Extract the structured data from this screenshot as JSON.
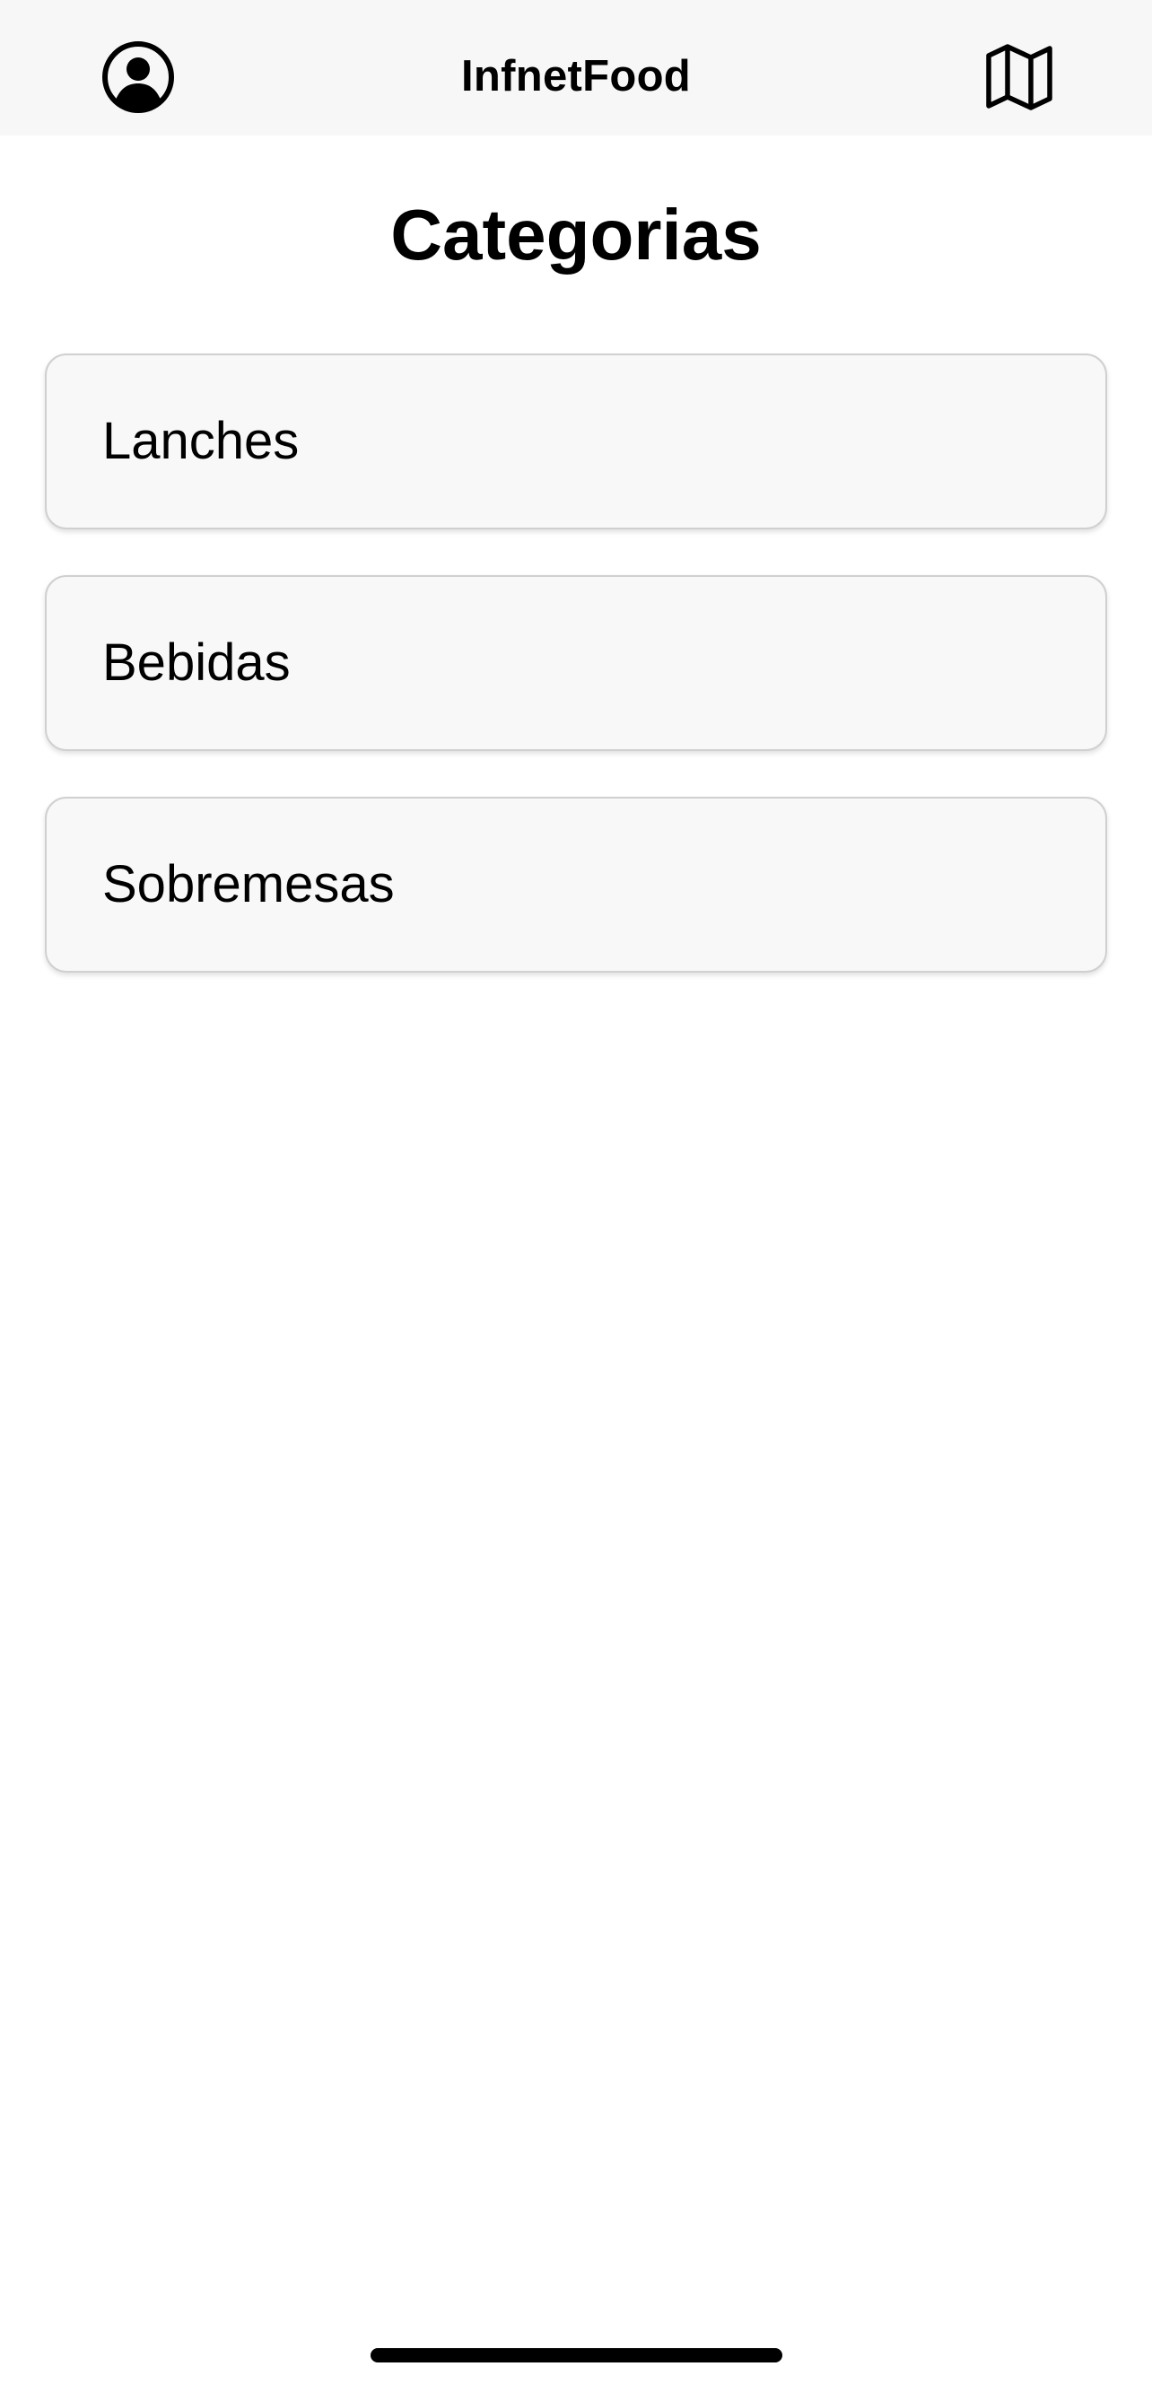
{
  "header": {
    "title": "InfnetFood",
    "left_icon": "user-circle-icon",
    "right_icon": "map-icon"
  },
  "main": {
    "title": "Categorias",
    "categories": [
      {
        "label": "Lanches"
      },
      {
        "label": "Bebidas"
      },
      {
        "label": "Sobremesas"
      }
    ]
  },
  "colors": {
    "header_bg": "#f7f7f7",
    "card_bg": "#f8f8f8",
    "card_border": "#d0d0d0",
    "text": "#000000"
  }
}
